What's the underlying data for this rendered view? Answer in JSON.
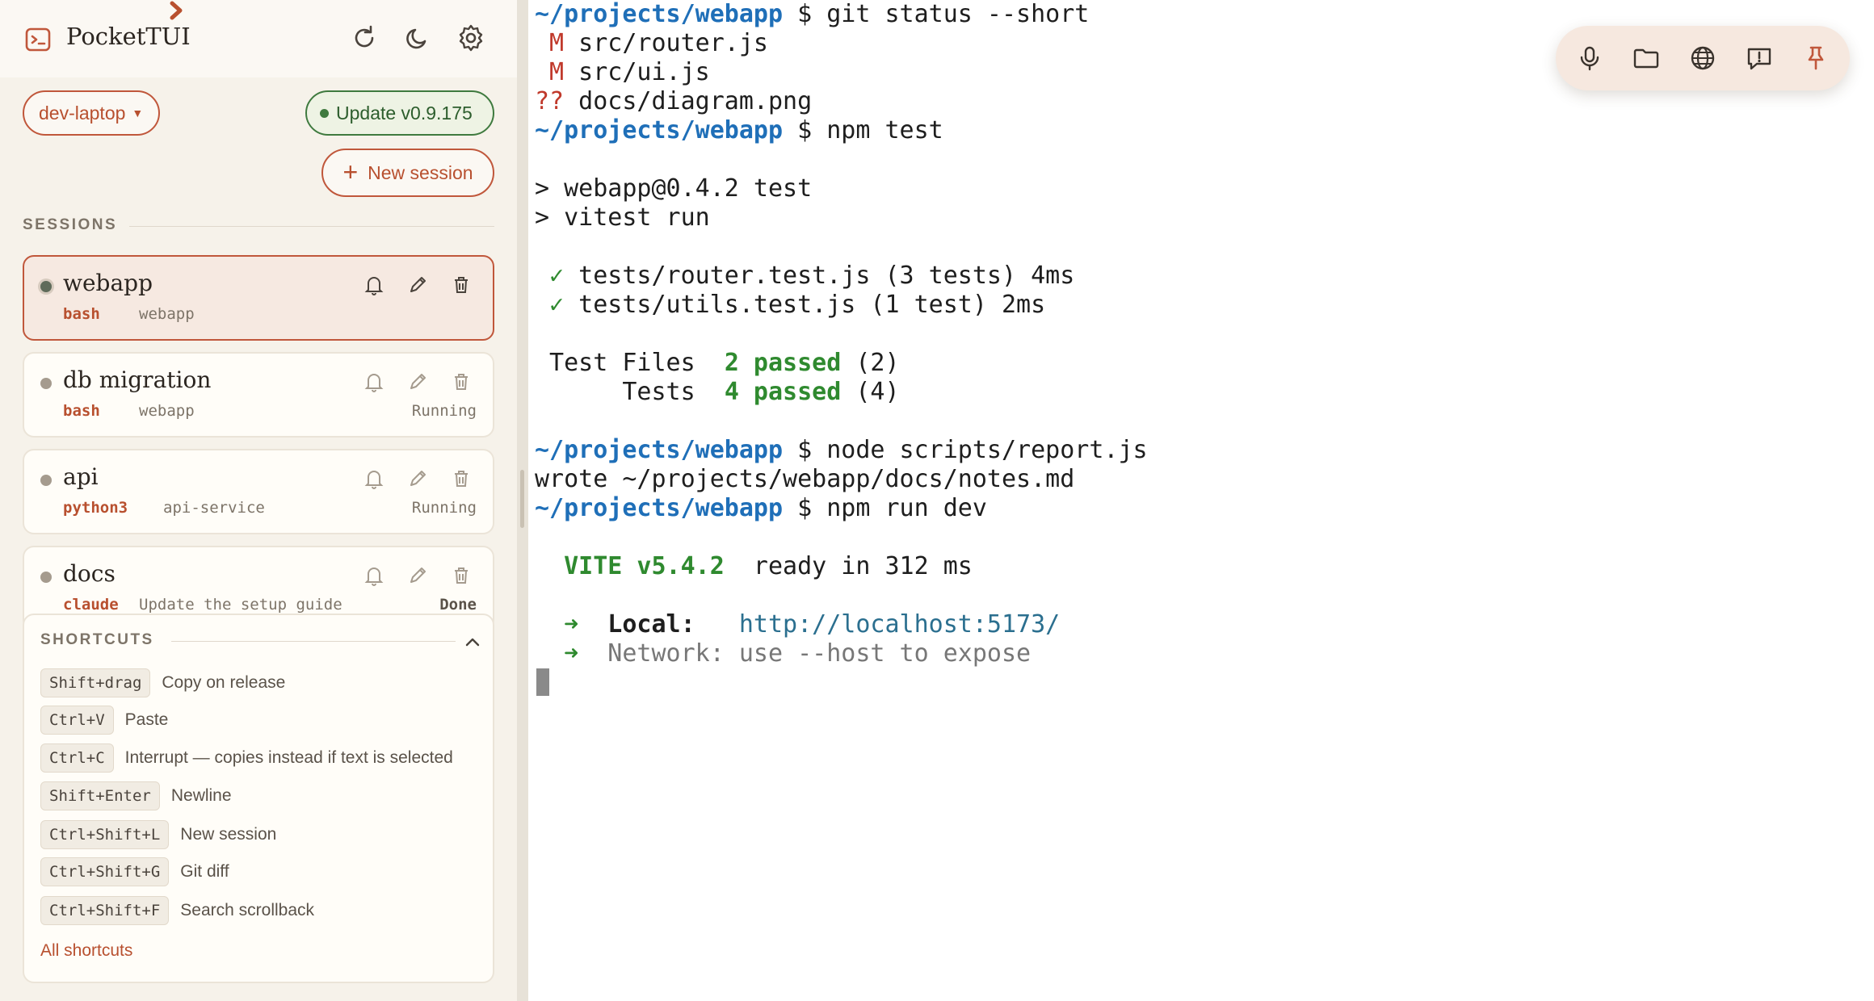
{
  "app": {
    "title": "PocketTUI"
  },
  "header": {
    "refresh_icon": "refresh-icon",
    "theme_icon": "moon-icon",
    "settings_icon": "gear-icon"
  },
  "host": {
    "label": "dev-laptop",
    "caret": "▼"
  },
  "update": {
    "label": "Update v0.9.175"
  },
  "new_session": {
    "plus": "+",
    "label": "New session"
  },
  "sessions": {
    "heading": "SESSIONS",
    "items": [
      {
        "name": "webapp",
        "command": "bash",
        "dir": "webapp",
        "status": ""
      },
      {
        "name": "db migration",
        "command": "bash",
        "dir": "webapp",
        "status": "Running"
      },
      {
        "name": "api",
        "command": "python3",
        "dir": "api-service",
        "status": "Running"
      },
      {
        "name": "docs",
        "command": "claude",
        "dir": "Update the setup guide",
        "status": "Done"
      }
    ]
  },
  "shortcuts": {
    "heading": "SHORTCUTS",
    "items": [
      {
        "key": "Shift+drag",
        "desc": "Copy on release"
      },
      {
        "key": "Ctrl+V",
        "desc": "Paste"
      },
      {
        "key": "Ctrl+C",
        "desc": "Interrupt — copies instead if text is selected"
      },
      {
        "key": "Shift+Enter",
        "desc": "Newline"
      },
      {
        "key": "Ctrl+Shift+L",
        "desc": "New session"
      },
      {
        "key": "Ctrl+Shift+G",
        "desc": "Git diff"
      },
      {
        "key": "Ctrl+Shift+F",
        "desc": "Search scrollback"
      }
    ],
    "all_link": "All shortcuts"
  },
  "terminal": {
    "prompt_path": "~/projects/webapp",
    "prompt_symbol": "$",
    "cmd1": "git status --short",
    "git_lines": [
      {
        "flag": " M",
        "file": " src/router.js"
      },
      {
        "flag": " M",
        "file": " src/ui.js"
      },
      {
        "flag": "??",
        "file": " docs/diagram.png"
      }
    ],
    "cmd2": "npm test",
    "npm_out1": "> webapp@0.4.2 test",
    "npm_out2": "> vitest run",
    "test_lines": [
      {
        "mark": " ✓",
        "text": " tests/router.test.js (3 tests) 4ms"
      },
      {
        "mark": " ✓",
        "text": " tests/utils.test.js (1 test) 2ms"
      }
    ],
    "files_label": " Test Files  ",
    "files_pass": "2 passed",
    "files_count": " (2)",
    "tests_label": "      Tests  ",
    "tests_pass": "4 passed",
    "tests_count": " (4)",
    "cmd3": "node scripts/report.js",
    "report_out": "wrote ~/projects/webapp/docs/notes.md",
    "cmd4": "npm run dev",
    "vite_label": "  VITE v5.4.2",
    "vite_ready": "  ready in 312 ms",
    "arrow": "  ➜",
    "local_label": "  Local:",
    "local_url": "   http://localhost:5173/",
    "network_line": "  Network: use --host to expose"
  },
  "toolbar": {
    "icons": [
      "microphone-icon",
      "folder-icon",
      "globe-icon",
      "feedback-icon",
      "pin-icon"
    ]
  },
  "colors": {
    "accent": "#c0573b",
    "prompt": "#1f6fb8",
    "success": "#2f8a2f",
    "sidebar_bg": "#f6f2ea"
  }
}
